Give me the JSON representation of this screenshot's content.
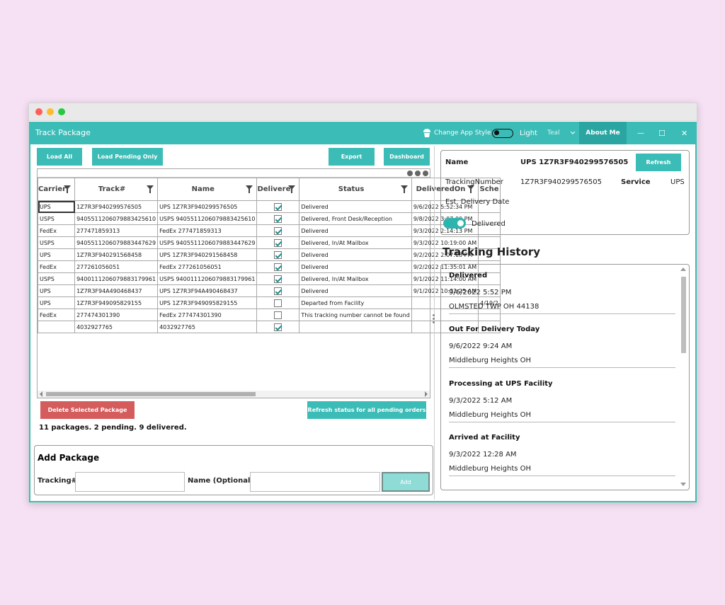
{
  "app": {
    "title": "Track Package",
    "change_style_label": "Change App Style",
    "theme_mode": "Light",
    "theme_color": "Teal",
    "about_label": "About Me",
    "minimize_glyph": "—",
    "maximize_glyph": "☐",
    "close_glyph": "✕"
  },
  "toolbar": {
    "load_all": "Load All",
    "load_pending": "Load Pending Only",
    "export": "Export",
    "dashboard": "Dashboard"
  },
  "grid": {
    "columns": [
      "Carrier",
      "Track#",
      "Name",
      "Delivere",
      "Status",
      "DeliveredOn",
      "Sche"
    ],
    "rows": [
      {
        "carrier": "UPS",
        "track": "1Z7R3F940299576505",
        "name": "UPS 1Z7R3F940299576505",
        "delivered": true,
        "status": "Delivered",
        "on": "9/6/2022 5:52:34 PM",
        "sched": ""
      },
      {
        "carrier": "USPS",
        "track": "9405511206079883425610",
        "name": "USPS 9405511206079883425610",
        "delivered": true,
        "status": "Delivered, Front Desk/Reception",
        "on": "9/8/2022 3:07:00 PM",
        "sched": ""
      },
      {
        "carrier": "FedEx",
        "track": "277471859313",
        "name": "FedEx 277471859313",
        "delivered": true,
        "status": "Delivered",
        "on": "9/3/2022 2:14:13 PM",
        "sched": ""
      },
      {
        "carrier": "USPS",
        "track": "9405511206079883447629",
        "name": "USPS 9405511206079883447629",
        "delivered": true,
        "status": "Delivered, In/At Mailbox",
        "on": "9/3/2022 10:19:00 AM",
        "sched": ""
      },
      {
        "carrier": "UPS",
        "track": "1Z7R3F940291568458",
        "name": "UPS 1Z7R3F940291568458",
        "delivered": true,
        "status": "Delivered",
        "on": "9/2/2022 2:07:13 PM",
        "sched": ""
      },
      {
        "carrier": "FedEx",
        "track": "277261056051",
        "name": "FedEx 277261056051",
        "delivered": true,
        "status": "Delivered",
        "on": "9/2/2022 11:35:01 AM",
        "sched": ""
      },
      {
        "carrier": "USPS",
        "track": "9400111206079883179961",
        "name": "USPS 9400111206079883179961",
        "delivered": true,
        "status": "Delivered, In/At Mailbox",
        "on": "9/1/2022 11:14:00 AM",
        "sched": ""
      },
      {
        "carrier": "UPS",
        "track": "1Z7R3F94A490468437",
        "name": "UPS 1Z7R3F94A490468437",
        "delivered": true,
        "status": "Delivered",
        "on": "9/1/2022 10:32:25 AM",
        "sched": ""
      },
      {
        "carrier": "UPS",
        "track": "1Z7R3F949095829155",
        "name": "UPS 1Z7R3F949095829155",
        "delivered": false,
        "status": "Departed from Facility",
        "on": "",
        "sched": "4/19/2"
      },
      {
        "carrier": "FedEx",
        "track": "277474301390",
        "name": "FedEx 277474301390",
        "delivered": false,
        "status": "This tracking number cannot be found",
        "on": "",
        "sched": ""
      },
      {
        "carrier": "",
        "track": "4032927765",
        "name": "4032927765",
        "delivered": true,
        "status": "",
        "on": "",
        "sched": ""
      }
    ]
  },
  "actions": {
    "delete_selected": "Delete Selected Package",
    "refresh_pending": "Refresh status for all pending orders"
  },
  "summary": "11 packages. 2 pending. 9 delivered.",
  "add_package": {
    "heading": "Add Package",
    "tracking_label": "Tracking#",
    "name_label": "Name (Optional)",
    "add_label": "Add",
    "tracking_value": "",
    "name_value": ""
  },
  "detail": {
    "name_label": "Name",
    "name_value": "UPS 1Z7R3F940299576505",
    "refresh_label": "Refresh",
    "tracking_label": "TrackingNumber",
    "tracking_value": "1Z7R3F940299576505",
    "service_label": "Service",
    "service_value": "UPS",
    "est_label": "Est. Delivery Date",
    "delivered_label": "Delivered",
    "delivered_on": true
  },
  "history": {
    "title": "Tracking History",
    "items": [
      {
        "title": "Delivered",
        "date": "9/6/2022 5:52 PM",
        "location": "OLMSTED TWP OH 44138"
      },
      {
        "title": "Out For Delivery Today",
        "date": "9/6/2022 9:24 AM",
        "location": "Middleburg Heights OH"
      },
      {
        "title": "Processing at UPS Facility",
        "date": "9/3/2022 5:12 AM",
        "location": "Middleburg Heights OH"
      },
      {
        "title": "Arrived at Facility",
        "date": "9/3/2022 12:28 AM",
        "location": "Middleburg Heights OH"
      }
    ]
  },
  "colors": {
    "accent": "#3bbcb7",
    "accent_dark": "#2aa5a1",
    "danger": "#d45c5c",
    "background": "#f6e1f4"
  }
}
